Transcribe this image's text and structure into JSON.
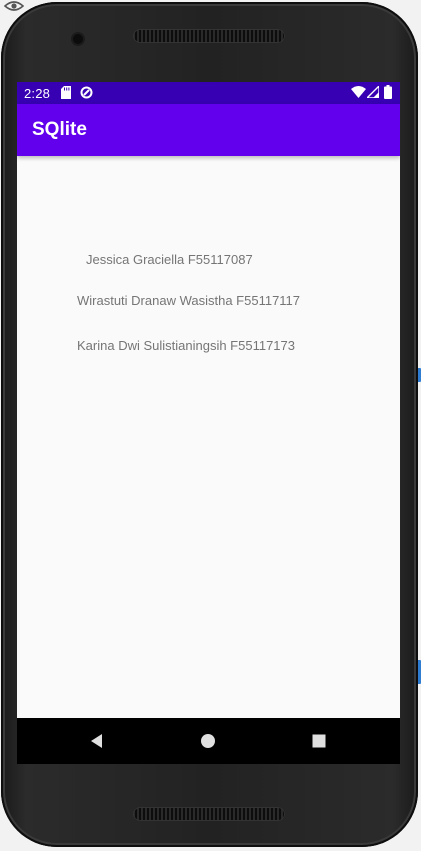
{
  "status_bar": {
    "time": "2:28",
    "icons": [
      "sd-card-icon",
      "data-saver-icon",
      "wifi-icon",
      "signal-icon",
      "battery-icon"
    ],
    "background_color": "#3700b3"
  },
  "app_bar": {
    "title": "SQlite",
    "background_color": "#6200ee"
  },
  "content": {
    "entries": [
      "Jessica Graciella F55117087",
      "Wirastuti Dranaw Wasistha F55117117",
      "Karina Dwi Sulistianingsih F55117173"
    ]
  },
  "nav_bar": {
    "buttons": [
      "back-icon",
      "home-icon",
      "recents-icon"
    ]
  }
}
